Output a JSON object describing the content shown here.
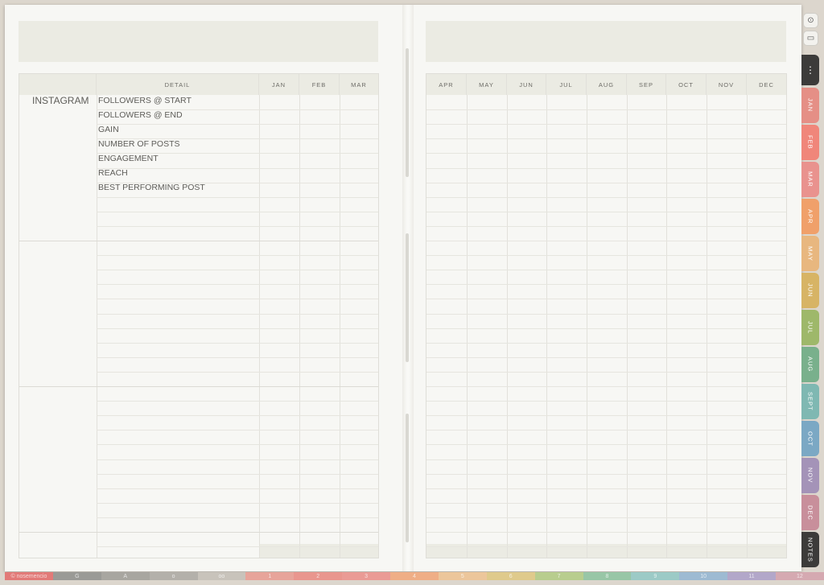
{
  "left_page": {
    "detail_header": "DETAIL",
    "months": [
      "JAN",
      "FEB",
      "MAR"
    ],
    "platform": "INSTAGRAM",
    "metrics": [
      "FOLLOWERS @ START",
      "FOLLOWERS @ END",
      "GAIN",
      "NUMBER OF POSTS",
      "ENGAGEMENT",
      "REACH",
      "BEST PERFORMING POST"
    ]
  },
  "right_page": {
    "months": [
      "APR",
      "MAY",
      "JUN",
      "JUL",
      "AUG",
      "SEP",
      "OCT",
      "NOV",
      "DEC"
    ]
  },
  "side_tabs": {
    "menu_icon": "more-dots-icon",
    "items": [
      {
        "label": "JAN",
        "color": "#e58f86"
      },
      {
        "label": "FEB",
        "color": "#f0867a"
      },
      {
        "label": "MAR",
        "color": "#e9928e"
      },
      {
        "label": "APR",
        "color": "#f0a06a"
      },
      {
        "label": "MAY",
        "color": "#e8b77f"
      },
      {
        "label": "JUN",
        "color": "#d7b465"
      },
      {
        "label": "JUL",
        "color": "#9eb86a"
      },
      {
        "label": "AUG",
        "color": "#79b08c"
      },
      {
        "label": "SEPT",
        "color": "#7fb8b2"
      },
      {
        "label": "OCT",
        "color": "#7ba8c4"
      },
      {
        "label": "NOV",
        "color": "#a493b8"
      },
      {
        "label": "DEC",
        "color": "#c88f9b"
      },
      {
        "label": "NOTES",
        "color": "#3c3b3a"
      }
    ]
  },
  "bottom_strip": {
    "labels": [
      "© nosemencio",
      "G",
      "A",
      "o",
      "oo",
      "1",
      "2",
      "3",
      "4",
      "5",
      "6",
      "7",
      "8",
      "9",
      "10",
      "11",
      "12"
    ],
    "colors": [
      "#e27a78",
      "#9a9a96",
      "#a8a6a0",
      "#b3b0aa",
      "#c8c3bb",
      "#e7a49a",
      "#e9968e",
      "#ea9b95",
      "#efae86",
      "#ecc69b",
      "#dfca8c",
      "#b8cd8e",
      "#98c6a6",
      "#9ccac6",
      "#9dbad2",
      "#b2a7c9",
      "#d5a9b1"
    ]
  }
}
